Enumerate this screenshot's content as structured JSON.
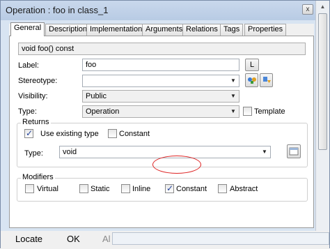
{
  "window": {
    "title": "Operation : foo in class_1",
    "close_glyph": "x"
  },
  "tabs": [
    "General",
    "Description",
    "Implementation",
    "Arguments",
    "Relations",
    "Tags",
    "Properties"
  ],
  "signature": "void foo() const",
  "label": {
    "caption": "Label:",
    "value": "foo",
    "button": "L"
  },
  "stereotype": {
    "caption": "Stereotype:",
    "value": ""
  },
  "visibility": {
    "caption": "Visibility:",
    "value": "Public"
  },
  "type": {
    "caption": "Type:",
    "value": "Operation",
    "template_label": "Template",
    "template_checked": false
  },
  "returns": {
    "legend": "Returns",
    "use_existing_label": "Use existing type",
    "use_existing_checked": true,
    "constant_label": "Constant",
    "constant_checked": false,
    "type_caption": "Type:",
    "type_value": "void"
  },
  "modifiers": {
    "legend": "Modifiers",
    "items": [
      {
        "label": "Virtual",
        "checked": false
      },
      {
        "label": "Static",
        "checked": false
      },
      {
        "label": "Inline",
        "checked": false
      },
      {
        "label": "Constant",
        "checked": true
      },
      {
        "label": "Abstract",
        "checked": false
      }
    ]
  },
  "footer": {
    "locate": "Locate",
    "ok": "OK",
    "partial": "Al"
  },
  "icons": {
    "close": "close-icon",
    "dropdown": "chevron-down-icon",
    "stereotype_add": "add-stereotype-icon",
    "stereotype_browse": "browse-stereotype-icon",
    "type_browse": "browse-type-icon"
  },
  "colors": {
    "accent_check": "#1f3f99",
    "highlight_circle": "#dd2222",
    "window_bg": "#d8e4f2"
  }
}
